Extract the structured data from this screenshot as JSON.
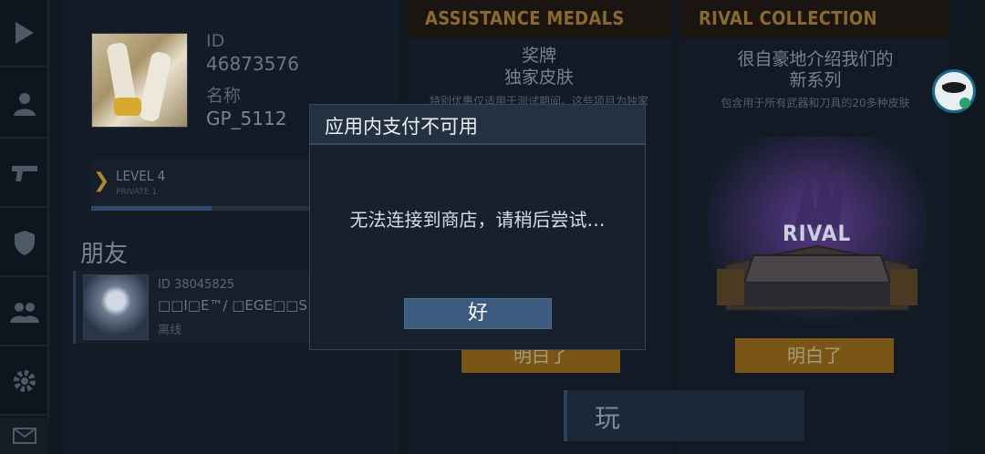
{
  "profile": {
    "id_label": "ID",
    "id_value": "46873576",
    "name_label": "名称",
    "name_value": "GP_5112",
    "level": "LEVEL 4",
    "rank": "PRIVATE 1",
    "xp_progress": 0.43
  },
  "friends": {
    "title": "朋友",
    "items": [
      {
        "id": "ID 38045825",
        "name": "□□I□E™/ □EGE□□S",
        "status": "离线"
      }
    ]
  },
  "medals_panel": {
    "title": "ASSISTANCE MEDALS",
    "heading_line1": "奖牌",
    "heading_line2": "独家皮肤",
    "description": "特别优惠仅适用于测试期间。这些项目为独家",
    "button": "明白了"
  },
  "rival_panel": {
    "title": "RIVAL COLLECTION",
    "heading_line1": "很自豪地介绍我们的",
    "heading_line2": "新系列",
    "description": "包含用于所有武器和刀具的20多种皮肤",
    "art_text": "RIVAL",
    "button": "明白了"
  },
  "play_button": "玩",
  "dialog": {
    "title": "应用内支付不可用",
    "message": "无法连接到商店，请稍后尝试…",
    "ok": "好"
  },
  "colors": {
    "accent_gold": "#8a6a2a",
    "dialog_button": "#3c5a7e"
  },
  "icons": [
    "play-icon",
    "user-icon",
    "pistol-icon",
    "shield-icon",
    "group-icon",
    "gear-icon",
    "mail-icon",
    "chat-avatar-icon"
  ]
}
